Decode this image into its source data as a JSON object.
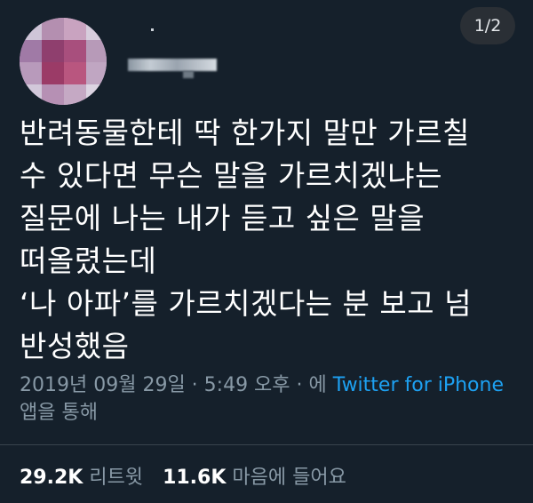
{
  "header": {
    "image_counter": "1/2"
  },
  "author": {
    "avatar_icon": "pixelated-avatar-icon",
    "name_censored": true
  },
  "tweet": {
    "lines": [
      "반려동물한테 딱 한가지 말만 가르칠",
      "수 있다면 무슨 말을 가르치겠냐는",
      "질문에 나는 내가 듣고 싶은 말을",
      "떠올렸는데",
      "‘나 아파’를 가르치겠다는 분 보고 넘",
      "반성했음"
    ]
  },
  "meta": {
    "timestamp": "2019년 09월 29일 · 5:49 오후 · 에",
    "app_link": "Twitter for iPhone",
    "via": "앱을 통해"
  },
  "stats": {
    "retweets_count": "29.2K",
    "retweets_label": "리트윗",
    "likes_count": "11.6K",
    "likes_label": "마음에 들어요"
  },
  "colors": {
    "background": "#15202b",
    "text": "#ffffff",
    "muted": "#8899a6",
    "link": "#1da1f2"
  }
}
